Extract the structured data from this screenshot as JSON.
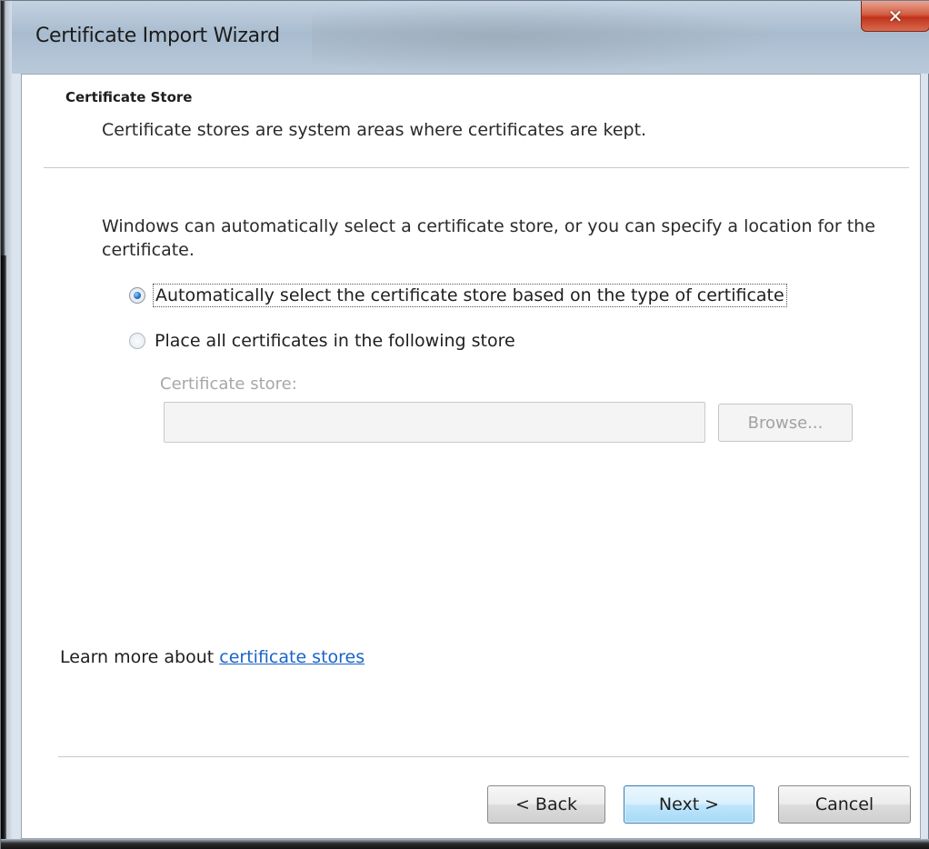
{
  "window": {
    "title": "Certificate Import Wizard",
    "close_icon": "close-icon"
  },
  "header": {
    "title": "Certificate Store",
    "subtitle": "Certificate stores are system areas where certificates are kept."
  },
  "body": {
    "intro": "Windows can automatically select a certificate store, or you can specify a location for the certificate.",
    "options": [
      {
        "label": "Automatically select the certificate store based on the type of certificate",
        "checked": true
      },
      {
        "label": "Place all certificates in the following store",
        "checked": false
      }
    ],
    "store_label": "Certificate store:",
    "store_value": "",
    "browse_label": "Browse...",
    "learn_more_prefix": "Learn more about ",
    "learn_more_link": "certificate stores"
  },
  "footer": {
    "back_label": "< Back",
    "next_label": "Next >",
    "cancel_label": "Cancel"
  },
  "colors": {
    "link": "#1a64c8",
    "close_button": "#c0341c",
    "default_button_border": "#3c7fb1"
  }
}
